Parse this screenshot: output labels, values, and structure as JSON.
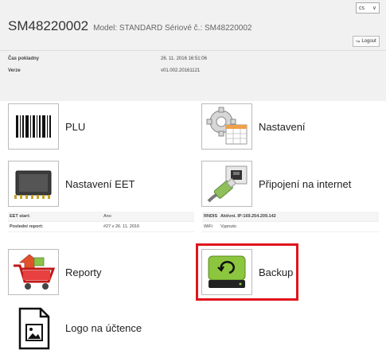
{
  "header": {
    "device_id": "SM48220002",
    "model_info": "Model: STANDARD Sériové č.: SM48220002",
    "language": "cs",
    "logout_label": "Logout",
    "info": [
      {
        "label": "Čas pokladny",
        "value": "26. 11. 2016 16:51:06"
      },
      {
        "label": "Verze",
        "value": "v01.002.20161121"
      }
    ]
  },
  "tiles": {
    "plu": {
      "label": "PLU",
      "icon": "barcode-icon"
    },
    "nastaveni": {
      "label": "Nastavení",
      "icon": "settings-gear-icon"
    },
    "eet": {
      "label": "Nastavení EET",
      "icon": "chip-icon"
    },
    "internet": {
      "label": "Připojení na internet",
      "icon": "ethernet-cable-icon"
    },
    "reporty": {
      "label": "Reporty",
      "icon": "shopping-cart-icon"
    },
    "backup": {
      "label": "Backup",
      "icon": "backup-drive-icon"
    },
    "logo": {
      "label": "Logo na účtence",
      "icon": "receipt-image-icon"
    }
  },
  "eet_status": [
    {
      "key": "EET start:",
      "value": "Ano"
    },
    {
      "key": "Poslední report:",
      "value": "#27 v 26. 11. 2016"
    }
  ],
  "net_status": [
    {
      "key": "RNDIS",
      "value": "Aktivní. IP:169.254.209.142"
    },
    {
      "key": "WiFi",
      "value": "Vypnuto"
    }
  ],
  "colors": {
    "highlight": "#e0141b",
    "header_bg": "#f1f1f1"
  }
}
